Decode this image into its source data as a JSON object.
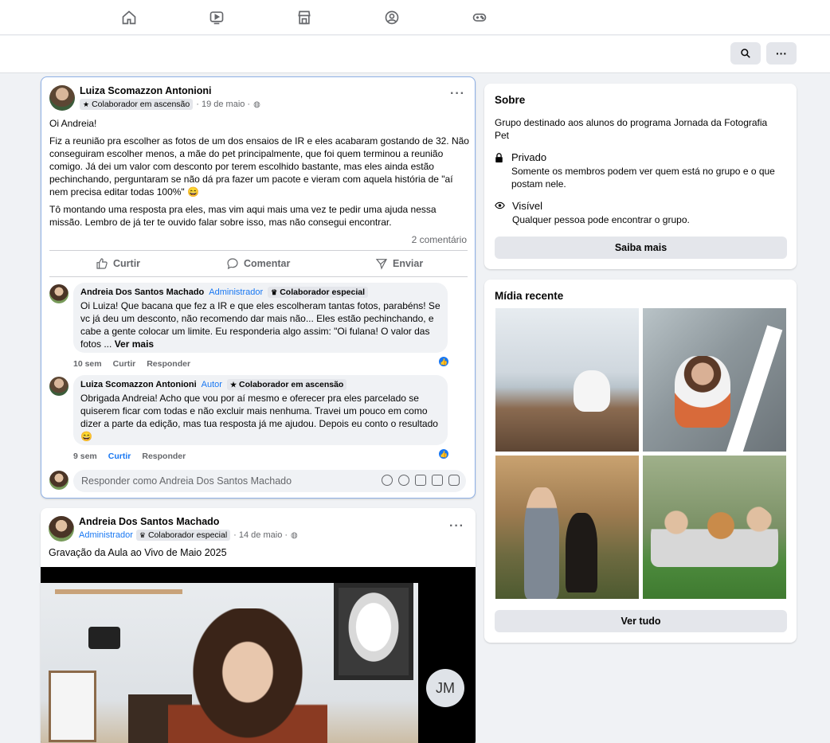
{
  "nav": {
    "icons": [
      "home-icon",
      "video-icon",
      "marketplace-icon",
      "groups-icon",
      "gaming-icon"
    ]
  },
  "colors": {
    "accent": "#1877f2",
    "muted": "#65676b",
    "bubble": "#f0f2f5"
  },
  "post1": {
    "author": "Luiza Scomazzon Antonioni",
    "badge": "Colaborador em ascensão",
    "date": "· 19 de maio ·",
    "paragraphs": [
      "Oi Andreia!",
      "Fiz a reunião pra escolher as fotos de um dos ensaios de IR e eles acabaram gostando de 32. Não conseguiram escolher menos, a mãe do pet principalmente, que foi quem terminou a reunião comigo. Já dei um valor com desconto por terem escolhido bastante, mas eles ainda estão pechinchando, perguntaram se não dá pra fazer um pacote e vieram com aquela história de \"aí nem precisa editar todas 100%\" 😄",
      "Tô montando uma resposta pra eles, mas vim aqui mais uma vez te pedir uma ajuda nessa missão. Lembro de já ter te ouvido falar sobre isso, mas não consegui encontrar."
    ],
    "comment_count": "2 comentário",
    "actions": {
      "like": "Curtir",
      "comment": "Comentar",
      "send": "Enviar"
    },
    "comments": [
      {
        "author": "Andreia Dos Santos Machado",
        "role": "Administrador",
        "badge": "Colaborador especial",
        "text": "Oi Luiza! Que bacana que fez a IR e que eles escolheram tantas fotos, parabéns! Se vc já deu um desconto, não recomendo dar mais não... Eles estão pechinchando, e cabe a gente colocar um limite. Eu responderia algo assim: \"Oi fulana! O valor das fotos ...",
        "more": "Ver mais",
        "time": "10 sem",
        "like": "Curtir",
        "reply": "Responder"
      },
      {
        "author": "Luiza Scomazzon Antonioni",
        "role": "Autor",
        "badge": "Colaborador em ascensão",
        "text": "Obrigada Andreia! Acho que vou por aí mesmo e oferecer pra eles parcelado se quiserem ficar com todas e não excluir mais nenhuma. Travei um pouco em como dizer a parte da edição, mas tua resposta já me ajudou. Depois eu conto o resultado 😄",
        "time": "9 sem",
        "like": "Curtir",
        "reply": "Responder"
      }
    ],
    "reply_placeholder": "Responder como Andreia Dos Santos Machado"
  },
  "post2": {
    "author": "Andreia Dos Santos Machado",
    "role": "Administrador",
    "badge": "Colaborador especial",
    "date": "· 14 de maio ·",
    "text": "Gravação da Aula ao Vivo de Maio 2025",
    "video_initials": "JM"
  },
  "sobre": {
    "title": "Sobre",
    "description": "Grupo destinado aos alunos do programa Jornada da Fotografia Pet",
    "privado_title": "Privado",
    "privado_desc": "Somente os membros podem ver quem está no grupo e o que postam nele.",
    "visivel_title": "Visível",
    "visivel_desc": "Qualquer pessoa pode encontrar o grupo.",
    "button": "Saiba mais"
  },
  "midia": {
    "title": "Mídia recente",
    "button": "Ver tudo"
  }
}
